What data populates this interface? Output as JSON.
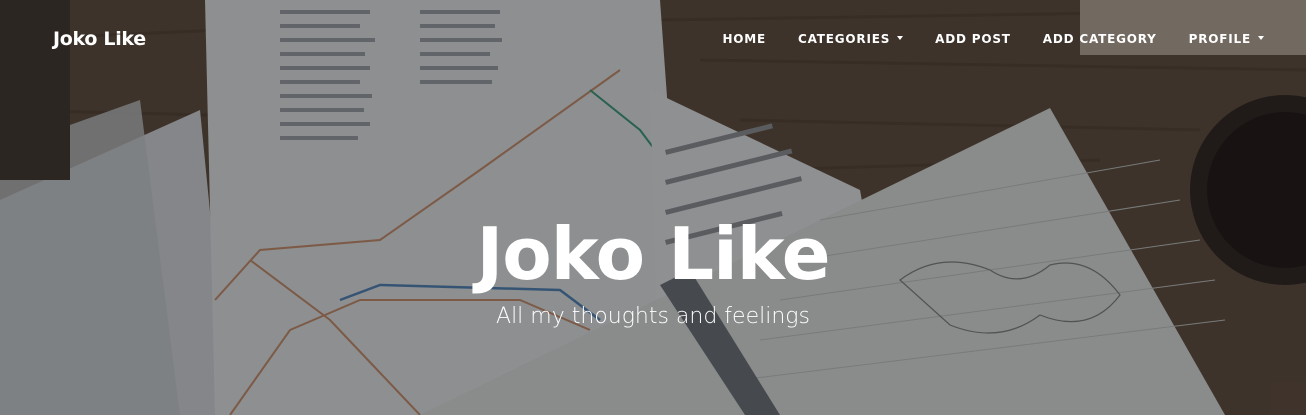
{
  "navbar": {
    "brand": "Joko Like",
    "items": [
      {
        "label": "HOME",
        "dropdown": false
      },
      {
        "label": "CATEGORIES",
        "dropdown": true
      },
      {
        "label": "ADD POST",
        "dropdown": false
      },
      {
        "label": "ADD CATEGORY",
        "dropdown": false
      },
      {
        "label": "PROFILE",
        "dropdown": true
      }
    ]
  },
  "hero": {
    "title": "Joko Like",
    "subtitle": "All my thoughts and feelings"
  }
}
